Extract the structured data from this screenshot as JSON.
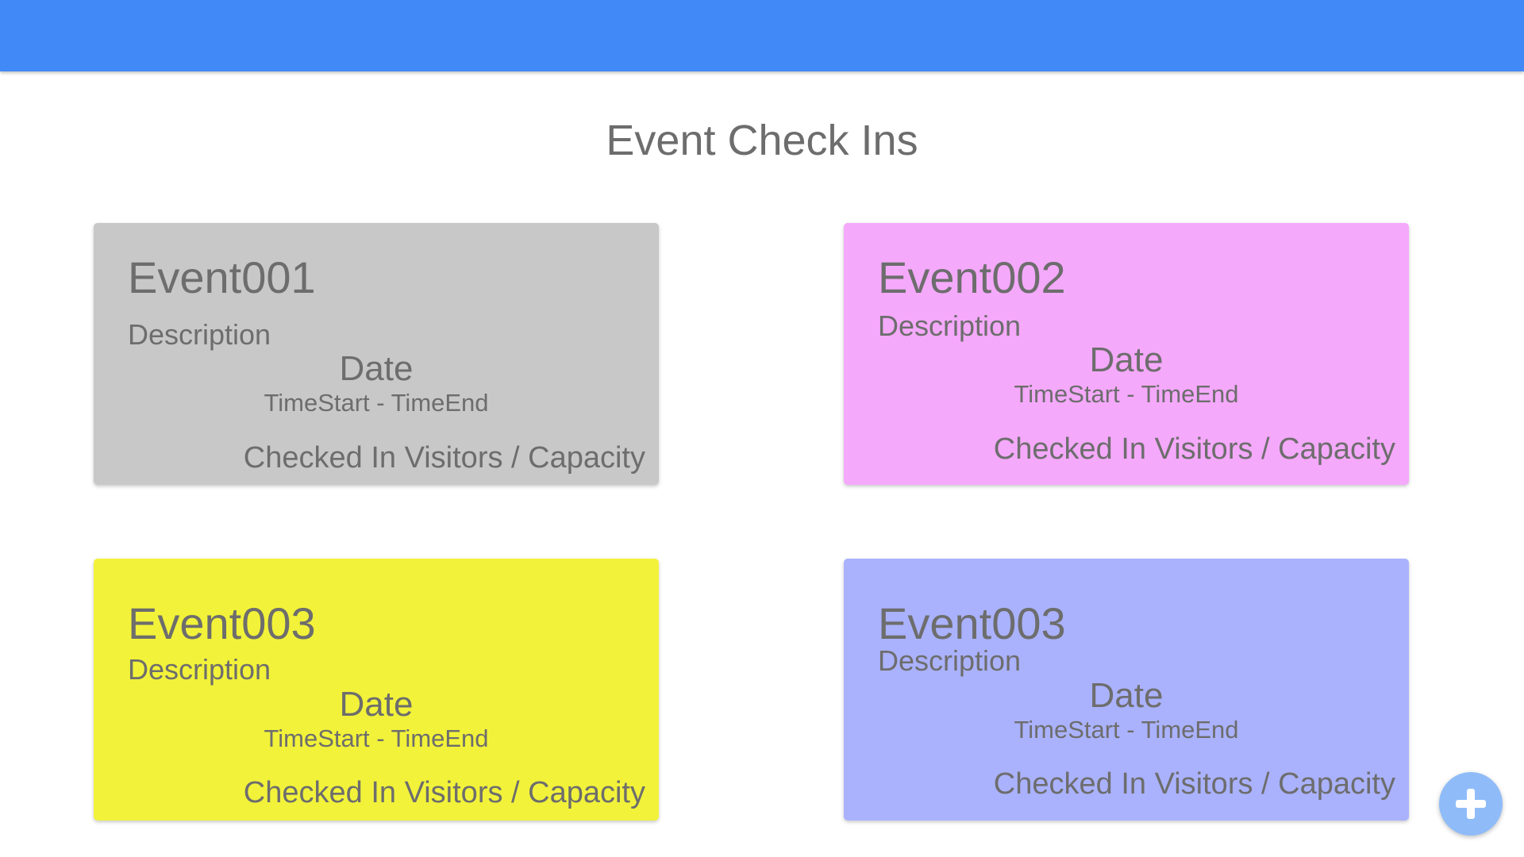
{
  "page": {
    "title": "Event Check Ins"
  },
  "colors": {
    "app_bar": "#4189f7",
    "text": "#6d6d6d",
    "fab": "#8fbcf9"
  },
  "events": [
    {
      "name": "Event001",
      "description": "Description",
      "date": "Date",
      "time": "TimeStart - TimeEnd",
      "capacity": "Checked In Visitors / Capacity",
      "color": "#c8c8c8"
    },
    {
      "name": "Event002",
      "description": "Description",
      "date": "Date",
      "time": "TimeStart - TimeEnd",
      "capacity": "Checked In Visitors / Capacity",
      "color": "#f5a9fb"
    },
    {
      "name": "Event003",
      "description": "Description",
      "date": "Date",
      "time": "TimeStart - TimeEnd",
      "capacity": "Checked In Visitors / Capacity",
      "color": "#f2f23a"
    },
    {
      "name": "Event003",
      "description": "Description",
      "date": "Date",
      "time": "TimeStart - TimeEnd",
      "capacity": "Checked In Visitors / Capacity",
      "color": "#aab2fd"
    }
  ],
  "fab": {
    "icon": "plus-icon"
  }
}
